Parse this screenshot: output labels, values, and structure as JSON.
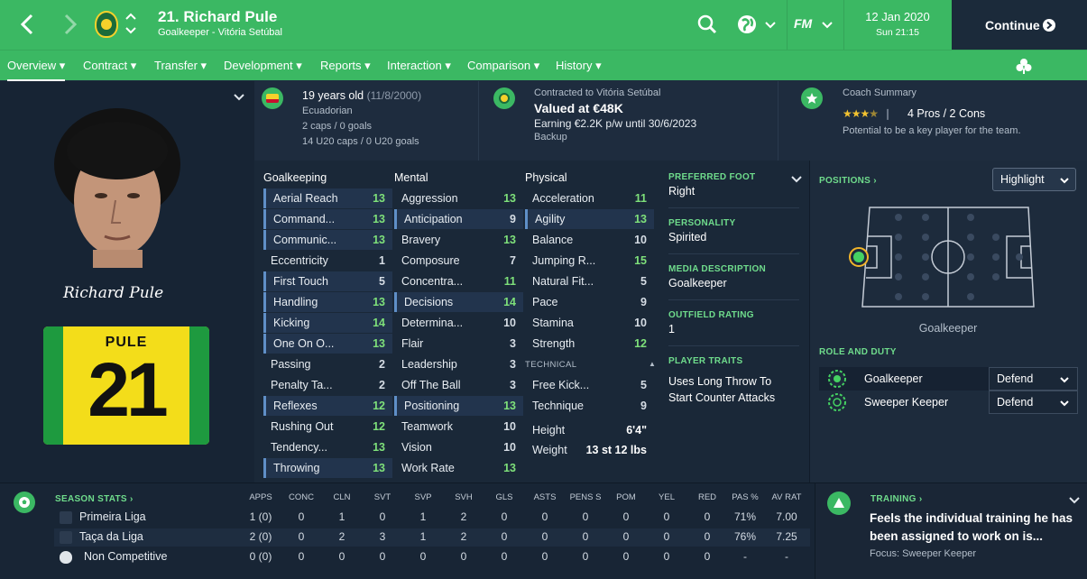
{
  "header": {
    "title": "21. Richard Pule",
    "subtitle": "Goalkeeper - Vitória Setúbal",
    "date": "12 Jan 2020",
    "time": "Sun 21:15",
    "continue_label": "Continue",
    "fm_label": "FM"
  },
  "nav": [
    "Overview",
    "Contract",
    "Transfer",
    "Development",
    "Reports",
    "Interaction",
    "Comparison",
    "History"
  ],
  "player": {
    "signature": "Richard Pule",
    "shirt_name": "PULE",
    "shirt_number": "21"
  },
  "info": {
    "age": "19 years old",
    "dob": "(11/8/2000)",
    "nationality": "Ecuadorian",
    "caps": "2 caps / 0 goals",
    "u20": "14 U20 caps / 0 U20 goals",
    "contract_label": "Contracted to Vitória Setúbal",
    "value": "Valued at €48K",
    "earning": "Earning €2.2K p/w until 30/6/2023",
    "squad_status": "Backup",
    "coach_title": "Coach Summary",
    "stars": 3.5,
    "pros_cons": "4 Pros / 2 Cons",
    "potential": "Potential to be a key player for the team."
  },
  "attributes": {
    "goalkeeping_title": "Goalkeeping",
    "mental_title": "Mental",
    "physical_title": "Physical",
    "technical_title": "TECHNICAL",
    "goalkeeping": [
      {
        "name": "Aerial Reach",
        "value": "13"
      },
      {
        "name": "Command...",
        "value": "13"
      },
      {
        "name": "Communic...",
        "value": "13"
      },
      {
        "name": "Eccentricity",
        "value": "1"
      },
      {
        "name": "First Touch",
        "value": "5"
      },
      {
        "name": "Handling",
        "value": "13"
      },
      {
        "name": "Kicking",
        "value": "14"
      },
      {
        "name": "One On O...",
        "value": "13"
      },
      {
        "name": "Passing",
        "value": "2"
      },
      {
        "name": "Penalty Ta...",
        "value": "2"
      },
      {
        "name": "Reflexes",
        "value": "12"
      },
      {
        "name": "Rushing Out",
        "value": "12"
      },
      {
        "name": "Tendency...",
        "value": "13"
      },
      {
        "name": "Throwing",
        "value": "13"
      }
    ],
    "mental": [
      {
        "name": "Aggression",
        "value": "13"
      },
      {
        "name": "Anticipation",
        "value": "9"
      },
      {
        "name": "Bravery",
        "value": "13"
      },
      {
        "name": "Composure",
        "value": "7"
      },
      {
        "name": "Concentra...",
        "value": "11"
      },
      {
        "name": "Decisions",
        "value": "14"
      },
      {
        "name": "Determina...",
        "value": "10"
      },
      {
        "name": "Flair",
        "value": "3"
      },
      {
        "name": "Leadership",
        "value": "3"
      },
      {
        "name": "Off The Ball",
        "value": "3"
      },
      {
        "name": "Positioning",
        "value": "13"
      },
      {
        "name": "Teamwork",
        "value": "10"
      },
      {
        "name": "Vision",
        "value": "10"
      },
      {
        "name": "Work Rate",
        "value": "13"
      }
    ],
    "physical": [
      {
        "name": "Acceleration",
        "value": "11"
      },
      {
        "name": "Agility",
        "value": "13"
      },
      {
        "name": "Balance",
        "value": "10"
      },
      {
        "name": "Jumping R...",
        "value": "15"
      },
      {
        "name": "Natural Fit...",
        "value": "5"
      },
      {
        "name": "Pace",
        "value": "9"
      },
      {
        "name": "Stamina",
        "value": "10"
      },
      {
        "name": "Strength",
        "value": "12"
      }
    ],
    "technical": [
      {
        "name": "Free Kick...",
        "value": "5"
      },
      {
        "name": "Technique",
        "value": "9"
      }
    ],
    "height_label": "Height",
    "height": "6'4\"",
    "weight_label": "Weight",
    "weight": "13 st 12 lbs"
  },
  "details": {
    "preferred_foot_label": "PREFERRED FOOT",
    "preferred_foot": "Right",
    "personality_label": "PERSONALITY",
    "personality": "Spirited",
    "media_label": "MEDIA DESCRIPTION",
    "media": "Goalkeeper",
    "outfield_label": "OUTFIELD RATING",
    "outfield": "1",
    "traits_label": "PLAYER TRAITS",
    "traits": "Uses Long Throw To Start Counter Attacks"
  },
  "positions": {
    "label": "POSITIONS",
    "highlight": "Highlight",
    "position_name": "Goalkeeper",
    "role_label": "ROLE AND DUTY",
    "roles": [
      {
        "role": "Goalkeeper",
        "duty": "Defend"
      },
      {
        "role": "Sweeper Keeper",
        "duty": "Defend"
      }
    ]
  },
  "season_stats": {
    "label": "SEASON STATS",
    "columns": [
      "APPS",
      "CONC",
      "CLN",
      "SVT",
      "SVP",
      "SVH",
      "GLS",
      "ASTS",
      "PENS S",
      "POM",
      "YEL",
      "RED",
      "PAS %",
      "AV RAT"
    ],
    "rows": [
      {
        "comp": "Primeira Liga",
        "values": [
          "1 (0)",
          "0",
          "1",
          "0",
          "1",
          "2",
          "0",
          "0",
          "0",
          "0",
          "0",
          "0",
          "71%",
          "7.00"
        ]
      },
      {
        "comp": "Taça da Liga",
        "values": [
          "2 (0)",
          "0",
          "2",
          "3",
          "1",
          "2",
          "0",
          "0",
          "0",
          "0",
          "0",
          "0",
          "76%",
          "7.25"
        ]
      },
      {
        "comp": "Non Competitive",
        "values": [
          "0 (0)",
          "0",
          "0",
          "0",
          "0",
          "0",
          "0",
          "0",
          "0",
          "0",
          "0",
          "0",
          "-",
          "-"
        ]
      }
    ]
  },
  "training": {
    "label": "TRAINING",
    "message": "Feels the individual training he has been assigned to work on is...",
    "focus": "Focus: Sweeper Keeper"
  }
}
